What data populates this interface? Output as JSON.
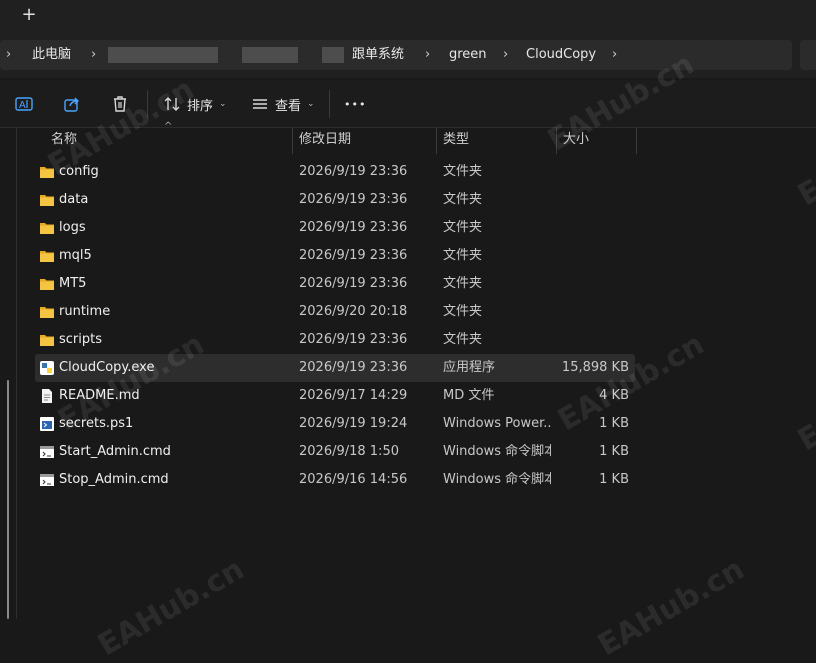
{
  "tabbar": {
    "new_tab": "+"
  },
  "breadcrumb": {
    "items": [
      "此电脑",
      "跟单系统",
      "green",
      "CloudCopy"
    ]
  },
  "toolbar": {
    "sort_label": "排序",
    "view_label": "查看",
    "more_label": "•••"
  },
  "columns": {
    "name": "名称",
    "modified": "修改日期",
    "type": "类型",
    "size": "大小"
  },
  "files": [
    {
      "name": "config",
      "modified": "2026/9/19 23:36",
      "type": "文件夹",
      "size": "",
      "icon": "folder-icon"
    },
    {
      "name": "data",
      "modified": "2026/9/19 23:36",
      "type": "文件夹",
      "size": "",
      "icon": "folder-icon"
    },
    {
      "name": "logs",
      "modified": "2026/9/19 23:36",
      "type": "文件夹",
      "size": "",
      "icon": "folder-icon"
    },
    {
      "name": "mql5",
      "modified": "2026/9/19 23:36",
      "type": "文件夹",
      "size": "",
      "icon": "folder-icon"
    },
    {
      "name": "MT5",
      "modified": "2026/9/19 23:36",
      "type": "文件夹",
      "size": "",
      "icon": "folder-icon"
    },
    {
      "name": "runtime",
      "modified": "2026/9/20 20:18",
      "type": "文件夹",
      "size": "",
      "icon": "folder-icon"
    },
    {
      "name": "scripts",
      "modified": "2026/9/19 23:36",
      "type": "文件夹",
      "size": "",
      "icon": "folder-icon"
    },
    {
      "name": "CloudCopy.exe",
      "modified": "2026/9/19 23:36",
      "type": "应用程序",
      "size": "15,898 KB",
      "icon": "python-exe-icon"
    },
    {
      "name": "README.md",
      "modified": "2026/9/17 14:29",
      "type": "MD 文件",
      "size": "4 KB",
      "icon": "document-icon"
    },
    {
      "name": "secrets.ps1",
      "modified": "2026/9/19 19:24",
      "type": "Windows Power...",
      "size": "1 KB",
      "icon": "powershell-script-icon"
    },
    {
      "name": "Start_Admin.cmd",
      "modified": "2026/9/18 1:50",
      "type": "Windows 命令脚本",
      "size": "1 KB",
      "icon": "cmd-script-icon"
    },
    {
      "name": "Stop_Admin.cmd",
      "modified": "2026/9/16 14:56",
      "type": "Windows 命令脚本",
      "size": "1 KB",
      "icon": "cmd-script-icon"
    }
  ],
  "watermark": "EAHub.cn",
  "colors": {
    "folder": "#f4c542",
    "selection": "#2d2d2d",
    "accent": "#4aa3ff"
  }
}
